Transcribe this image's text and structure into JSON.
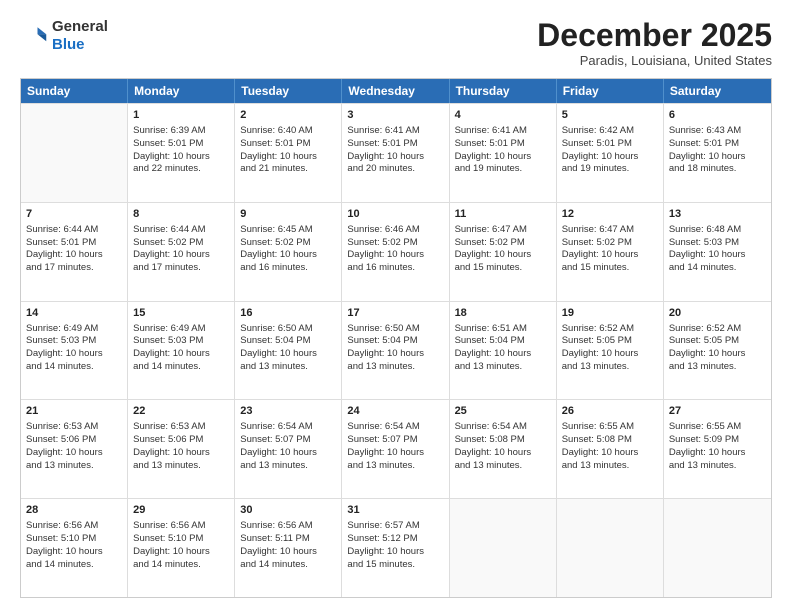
{
  "logo": {
    "line1": "General",
    "line2": "Blue"
  },
  "header": {
    "month": "December 2025",
    "location": "Paradis, Louisiana, United States"
  },
  "weekdays": [
    "Sunday",
    "Monday",
    "Tuesday",
    "Wednesday",
    "Thursday",
    "Friday",
    "Saturday"
  ],
  "rows": [
    [
      {
        "day": "",
        "lines": []
      },
      {
        "day": "1",
        "lines": [
          "Sunrise: 6:39 AM",
          "Sunset: 5:01 PM",
          "Daylight: 10 hours",
          "and 22 minutes."
        ]
      },
      {
        "day": "2",
        "lines": [
          "Sunrise: 6:40 AM",
          "Sunset: 5:01 PM",
          "Daylight: 10 hours",
          "and 21 minutes."
        ]
      },
      {
        "day": "3",
        "lines": [
          "Sunrise: 6:41 AM",
          "Sunset: 5:01 PM",
          "Daylight: 10 hours",
          "and 20 minutes."
        ]
      },
      {
        "day": "4",
        "lines": [
          "Sunrise: 6:41 AM",
          "Sunset: 5:01 PM",
          "Daylight: 10 hours",
          "and 19 minutes."
        ]
      },
      {
        "day": "5",
        "lines": [
          "Sunrise: 6:42 AM",
          "Sunset: 5:01 PM",
          "Daylight: 10 hours",
          "and 19 minutes."
        ]
      },
      {
        "day": "6",
        "lines": [
          "Sunrise: 6:43 AM",
          "Sunset: 5:01 PM",
          "Daylight: 10 hours",
          "and 18 minutes."
        ]
      }
    ],
    [
      {
        "day": "7",
        "lines": [
          "Sunrise: 6:44 AM",
          "Sunset: 5:01 PM",
          "Daylight: 10 hours",
          "and 17 minutes."
        ]
      },
      {
        "day": "8",
        "lines": [
          "Sunrise: 6:44 AM",
          "Sunset: 5:02 PM",
          "Daylight: 10 hours",
          "and 17 minutes."
        ]
      },
      {
        "day": "9",
        "lines": [
          "Sunrise: 6:45 AM",
          "Sunset: 5:02 PM",
          "Daylight: 10 hours",
          "and 16 minutes."
        ]
      },
      {
        "day": "10",
        "lines": [
          "Sunrise: 6:46 AM",
          "Sunset: 5:02 PM",
          "Daylight: 10 hours",
          "and 16 minutes."
        ]
      },
      {
        "day": "11",
        "lines": [
          "Sunrise: 6:47 AM",
          "Sunset: 5:02 PM",
          "Daylight: 10 hours",
          "and 15 minutes."
        ]
      },
      {
        "day": "12",
        "lines": [
          "Sunrise: 6:47 AM",
          "Sunset: 5:02 PM",
          "Daylight: 10 hours",
          "and 15 minutes."
        ]
      },
      {
        "day": "13",
        "lines": [
          "Sunrise: 6:48 AM",
          "Sunset: 5:03 PM",
          "Daylight: 10 hours",
          "and 14 minutes."
        ]
      }
    ],
    [
      {
        "day": "14",
        "lines": [
          "Sunrise: 6:49 AM",
          "Sunset: 5:03 PM",
          "Daylight: 10 hours",
          "and 14 minutes."
        ]
      },
      {
        "day": "15",
        "lines": [
          "Sunrise: 6:49 AM",
          "Sunset: 5:03 PM",
          "Daylight: 10 hours",
          "and 14 minutes."
        ]
      },
      {
        "day": "16",
        "lines": [
          "Sunrise: 6:50 AM",
          "Sunset: 5:04 PM",
          "Daylight: 10 hours",
          "and 13 minutes."
        ]
      },
      {
        "day": "17",
        "lines": [
          "Sunrise: 6:50 AM",
          "Sunset: 5:04 PM",
          "Daylight: 10 hours",
          "and 13 minutes."
        ]
      },
      {
        "day": "18",
        "lines": [
          "Sunrise: 6:51 AM",
          "Sunset: 5:04 PM",
          "Daylight: 10 hours",
          "and 13 minutes."
        ]
      },
      {
        "day": "19",
        "lines": [
          "Sunrise: 6:52 AM",
          "Sunset: 5:05 PM",
          "Daylight: 10 hours",
          "and 13 minutes."
        ]
      },
      {
        "day": "20",
        "lines": [
          "Sunrise: 6:52 AM",
          "Sunset: 5:05 PM",
          "Daylight: 10 hours",
          "and 13 minutes."
        ]
      }
    ],
    [
      {
        "day": "21",
        "lines": [
          "Sunrise: 6:53 AM",
          "Sunset: 5:06 PM",
          "Daylight: 10 hours",
          "and 13 minutes."
        ]
      },
      {
        "day": "22",
        "lines": [
          "Sunrise: 6:53 AM",
          "Sunset: 5:06 PM",
          "Daylight: 10 hours",
          "and 13 minutes."
        ]
      },
      {
        "day": "23",
        "lines": [
          "Sunrise: 6:54 AM",
          "Sunset: 5:07 PM",
          "Daylight: 10 hours",
          "and 13 minutes."
        ]
      },
      {
        "day": "24",
        "lines": [
          "Sunrise: 6:54 AM",
          "Sunset: 5:07 PM",
          "Daylight: 10 hours",
          "and 13 minutes."
        ]
      },
      {
        "day": "25",
        "lines": [
          "Sunrise: 6:54 AM",
          "Sunset: 5:08 PM",
          "Daylight: 10 hours",
          "and 13 minutes."
        ]
      },
      {
        "day": "26",
        "lines": [
          "Sunrise: 6:55 AM",
          "Sunset: 5:08 PM",
          "Daylight: 10 hours",
          "and 13 minutes."
        ]
      },
      {
        "day": "27",
        "lines": [
          "Sunrise: 6:55 AM",
          "Sunset: 5:09 PM",
          "Daylight: 10 hours",
          "and 13 minutes."
        ]
      }
    ],
    [
      {
        "day": "28",
        "lines": [
          "Sunrise: 6:56 AM",
          "Sunset: 5:10 PM",
          "Daylight: 10 hours",
          "and 14 minutes."
        ]
      },
      {
        "day": "29",
        "lines": [
          "Sunrise: 6:56 AM",
          "Sunset: 5:10 PM",
          "Daylight: 10 hours",
          "and 14 minutes."
        ]
      },
      {
        "day": "30",
        "lines": [
          "Sunrise: 6:56 AM",
          "Sunset: 5:11 PM",
          "Daylight: 10 hours",
          "and 14 minutes."
        ]
      },
      {
        "day": "31",
        "lines": [
          "Sunrise: 6:57 AM",
          "Sunset: 5:12 PM",
          "Daylight: 10 hours",
          "and 15 minutes."
        ]
      },
      {
        "day": "",
        "lines": []
      },
      {
        "day": "",
        "lines": []
      },
      {
        "day": "",
        "lines": []
      }
    ]
  ]
}
